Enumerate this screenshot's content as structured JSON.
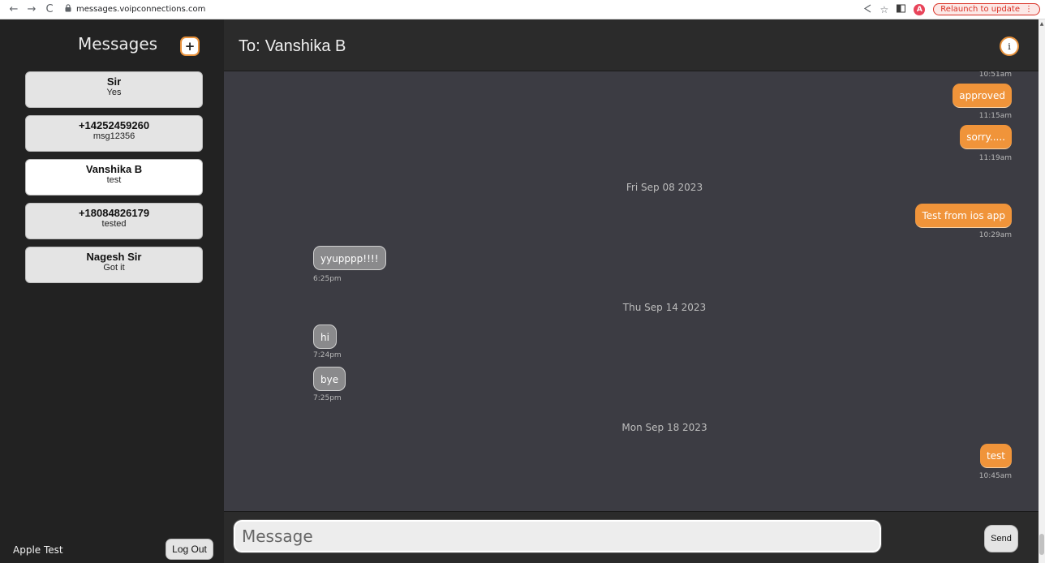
{
  "browser": {
    "back_icon": "←",
    "forward_icon": "→",
    "reload_icon": "C",
    "url": "messages.voipconnections.com",
    "profile_initial": "A",
    "relaunch_label": "Relaunch to update",
    "menu_icon": "⋮"
  },
  "sidebar": {
    "title": "Messages",
    "new_button": "+",
    "conversations": [
      {
        "name": "Sir",
        "preview": "Yes"
      },
      {
        "name": "+14252459260",
        "preview": "msg12356"
      },
      {
        "name": "Vanshika B",
        "preview": "test"
      },
      {
        "name": "+18084826179",
        "preview": "tested"
      },
      {
        "name": "Nagesh Sir",
        "preview": "Got it"
      }
    ],
    "user_name": "Apple Test",
    "logout_label": "Log Out"
  },
  "header": {
    "to_label": "To:",
    "recipient": "Vanshika B",
    "info_button": "i"
  },
  "thread": {
    "top_timestamp": "10:51am",
    "messages": [
      {
        "dir": "out",
        "text": "approved",
        "time": "11:15am"
      },
      {
        "dir": "out",
        "text": "sorry.....",
        "time": "11:19am"
      },
      {
        "dir": "out",
        "text": "Test from ios app",
        "time": "10:29am"
      },
      {
        "dir": "in",
        "text": "yyupppp!!!!",
        "time": "6:25pm"
      },
      {
        "dir": "in",
        "text": "hi",
        "time": "7:24pm"
      },
      {
        "dir": "in",
        "text": "bye",
        "time": "7:25pm"
      },
      {
        "dir": "out",
        "text": "test",
        "time": "10:45am"
      }
    ],
    "dates": [
      "Fri Sep 08 2023",
      "Thu Sep 14 2023",
      "Mon Sep 18 2023"
    ]
  },
  "composer": {
    "placeholder": "Message",
    "send_label": "Send"
  }
}
